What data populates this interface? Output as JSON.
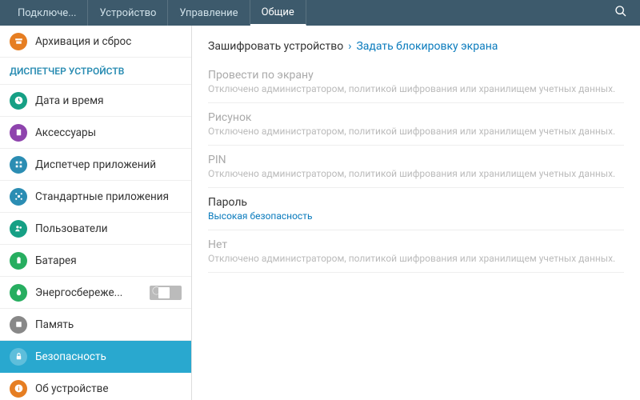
{
  "tabs": {
    "t0": "Подключе...",
    "t1": "Устройство",
    "t2": "Управление",
    "t3": "Общие"
  },
  "sidebar": {
    "archive": "Архивация и сброс",
    "header": "ДИСПЕТЧЕР УСТРОЙСТВ",
    "datetime": "Дата и время",
    "accessories": "Аксессуары",
    "appmgr": "Диспетчер приложений",
    "defaultapps": "Стандартные приложения",
    "users": "Пользователи",
    "battery": "Батарея",
    "powersave": "Энергосбереже...",
    "memory": "Память",
    "security": "Безопасность",
    "about": "Об устройстве"
  },
  "breadcrumb": {
    "b0": "Зашифровать устройство",
    "b1": "Задать блокировку экрана"
  },
  "options": {
    "swipe": {
      "title": "Провести по экрану",
      "sub": "Отключено администратором, политикой шифрования или хранилищем учетных данных."
    },
    "pattern": {
      "title": "Рисунок",
      "sub": "Отключено администратором, политикой шифрования или хранилищем учетных данных."
    },
    "pin": {
      "title": "PIN",
      "sub": "Отключено администратором, политикой шифрования или хранилищем учетных данных."
    },
    "password": {
      "title": "Пароль",
      "sub": "Высокая безопасность"
    },
    "none": {
      "title": "Нет",
      "sub": "Отключено администратором, политикой шифрования или хранилищем учетных данных."
    }
  },
  "colors": {
    "orange": "#e67e22",
    "teal": "#16a085",
    "purple": "#8e44ad",
    "blue": "#2b8db3",
    "green": "#27ae60",
    "gray": "#888888",
    "accent": "#29a8cf"
  }
}
